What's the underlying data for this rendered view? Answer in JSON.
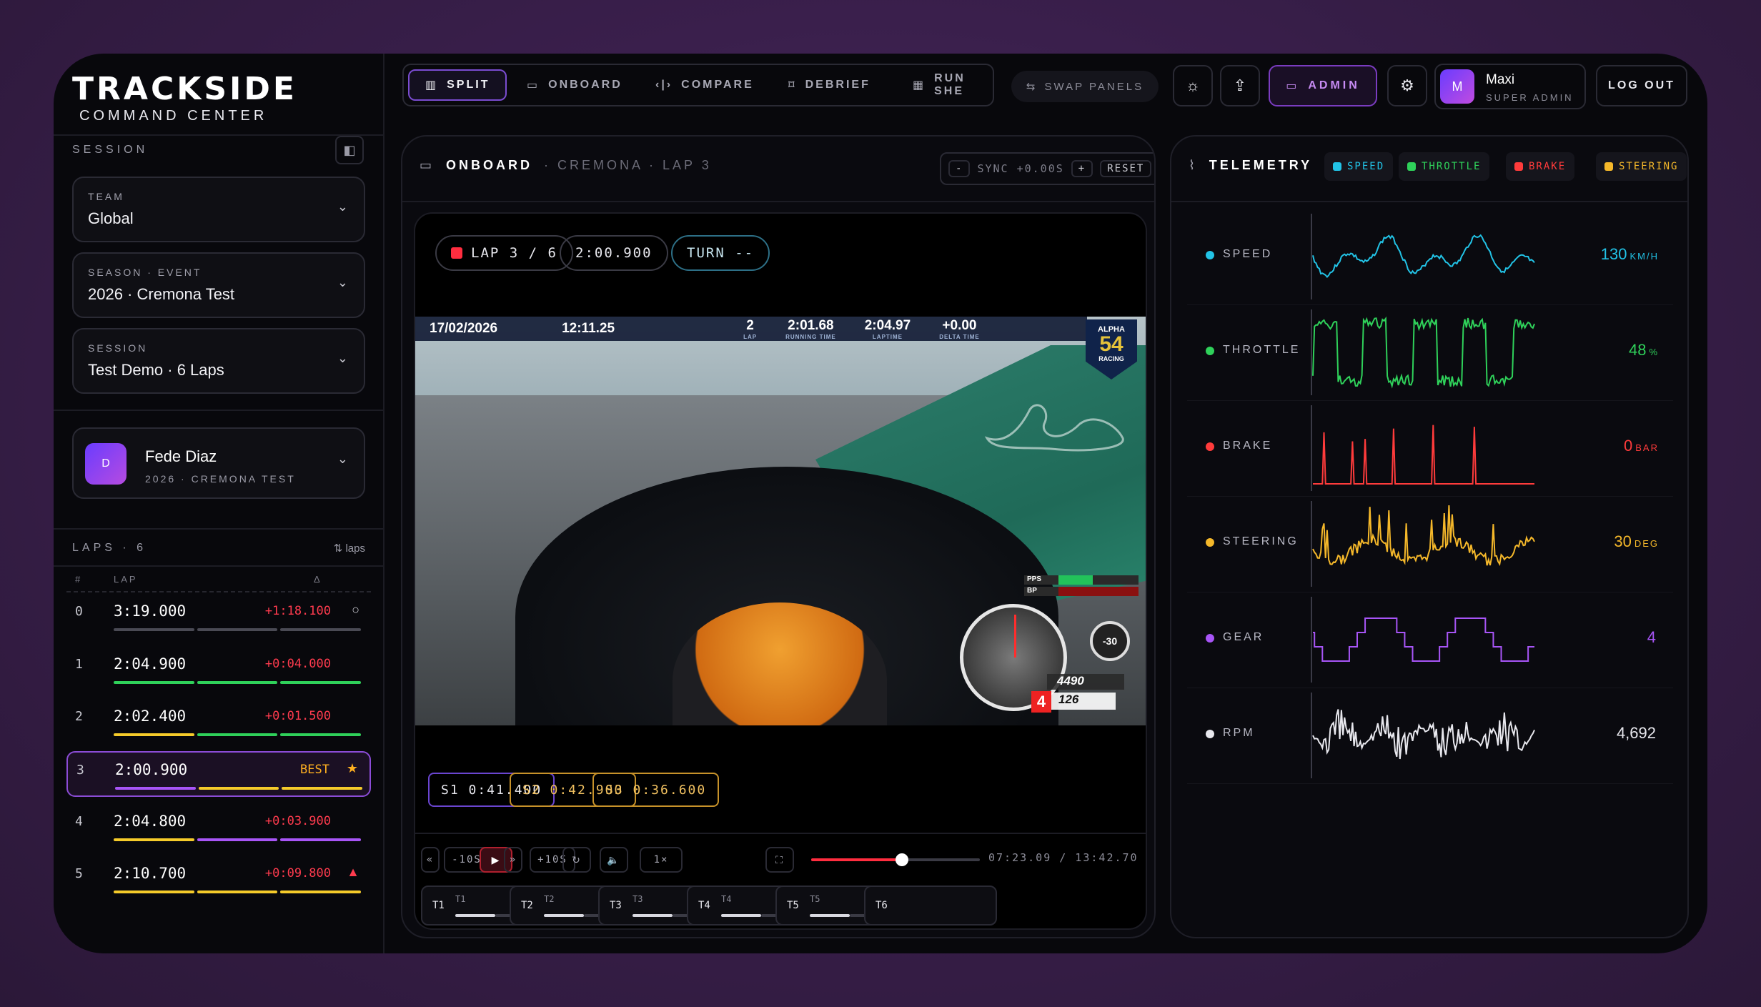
{
  "brand": {
    "title": "TRACKSIDE",
    "subtitle": "COMMAND CENTER"
  },
  "sidebar": {
    "session_title": "SESSION",
    "selects": [
      {
        "label": "TEAM",
        "value": "Global"
      },
      {
        "label": "SEASON · EVENT",
        "value": "2026 · Cremona Test"
      },
      {
        "label": "SESSION",
        "value": "Test Demo · 6 Laps"
      }
    ],
    "driver": {
      "initial": "D",
      "name": "Fede Diaz",
      "sub": "2026 · CREMONA TEST"
    },
    "laps_title": "LAPS · 6",
    "laps_sort": "laps",
    "columns": {
      "num": "#",
      "lap": "LAP",
      "delta": "Δ"
    },
    "laps": [
      {
        "num": "0",
        "time": "3:19.000",
        "delta": "+1:18.100",
        "mark": "○",
        "bars": [
          "#4a4a54",
          "#4a4a54",
          "#4a4a54"
        ]
      },
      {
        "num": "1",
        "time": "2:04.900",
        "delta": "+0:04.000",
        "mark": "",
        "bars": [
          "#2fd15a",
          "#2fd15a",
          "#2fd15a"
        ]
      },
      {
        "num": "2",
        "time": "2:02.400",
        "delta": "+0:01.500",
        "mark": "",
        "bars": [
          "#f5cb2a",
          "#2fd15a",
          "#2fd15a"
        ]
      },
      {
        "num": "3",
        "time": "2:00.900",
        "delta": "BEST",
        "mark": "★",
        "bars": [
          "#a855f7",
          "#f5cb2a",
          "#f5cb2a"
        ]
      },
      {
        "num": "4",
        "time": "2:04.800",
        "delta": "+0:03.900",
        "mark": "",
        "bars": [
          "#f5cb2a",
          "#a855f7",
          "#a855f7"
        ]
      },
      {
        "num": "5",
        "time": "2:10.700",
        "delta": "+0:09.800",
        "mark": "▲",
        "bars": [
          "#f5cb2a",
          "#f5cb2a",
          "#f5cb2a"
        ]
      }
    ]
  },
  "nav": {
    "tabs": [
      {
        "label": "SPLIT",
        "icon": "columns-icon"
      },
      {
        "label": "ONBOARD",
        "icon": "camera-icon"
      },
      {
        "label": "COMPARE",
        "icon": "compare-icon"
      },
      {
        "label": "DEBRIEF",
        "icon": "bookmark-icon"
      },
      {
        "label": "RUN SHE",
        "icon": "grid-icon"
      }
    ],
    "swap": "SWAP PANELS",
    "admin": "ADMIN",
    "user": {
      "initial": "M",
      "name": "Maxi",
      "role": "SUPER ADMIN"
    },
    "logout": "LOG OUT"
  },
  "onboard": {
    "title": "ONBOARD",
    "context": "· CREMONA · LAP 3",
    "sync": {
      "minus": "-",
      "label": "SYNC +0.00S",
      "plus": "+",
      "reset": "RESET"
    },
    "chips": {
      "lap": "LAP 3 / 6",
      "time": "2:00.900",
      "turn": "TURN --"
    },
    "hud": {
      "date": "17/02/2026",
      "clock": "12:11.25",
      "lap": "2",
      "lap_sub": "LAP",
      "running": "2:01.68",
      "running_sub": "RUNNING TIME",
      "laptime": "2:04.97",
      "laptime_sub": "LAPTIME",
      "delta": "+0.00",
      "delta_sub": "DELTA TIME",
      "badge": [
        "ALPHA",
        "54",
        "RACING"
      ],
      "pps": "PPS",
      "bp": "BP",
      "rpm": "4490",
      "gear": "4",
      "speed": "126",
      "round": "-30"
    },
    "sectors": [
      {
        "label": "S1 0:41.400",
        "color": "#7a55e0"
      },
      {
        "label": "S2 0:42.900",
        "color": "#d9a52a"
      },
      {
        "label": "S3 0:36.600",
        "color": "#d9a52a"
      }
    ],
    "controls": {
      "rew": "«",
      "back10": "-10S",
      "fwd": "»",
      "fwd10": "+10S",
      "speed": "1×"
    },
    "playback": {
      "current": "07:23.09",
      "total": "13:42.70",
      "progress": 0.54
    },
    "time_readout": "07:23.09  /  13:42.70",
    "turns": [
      {
        "label": "T1",
        "sub": "T1",
        "value": "--"
      },
      {
        "label": "T2",
        "sub": "T2",
        "value": "--"
      },
      {
        "label": "T3",
        "sub": "T3",
        "value": "--"
      },
      {
        "label": "T4",
        "sub": "T4",
        "value": "--"
      },
      {
        "label": "T5",
        "sub": "T5",
        "value": "--"
      },
      {
        "label": "T6",
        "sub": "",
        "value": ""
      }
    ]
  },
  "telemetry": {
    "title": "TELEMETRY",
    "legend": [
      {
        "label": "SPEED",
        "color": "#22c3e6"
      },
      {
        "label": "THROTTLE",
        "color": "#2fd15a"
      },
      {
        "label": "BRAKE",
        "color": "#ff3b3b"
      },
      {
        "label": "STEERING",
        "color": "#f5b82a"
      }
    ],
    "channels": [
      {
        "name": "SPEED",
        "value": "130",
        "unit": "KM/H",
        "color": "#22c3e6"
      },
      {
        "name": "THROTTLE",
        "value": "48",
        "unit": "%",
        "color": "#2fd15a"
      },
      {
        "name": "BRAKE",
        "value": "0",
        "unit": "BAR",
        "color": "#ff3b3b"
      },
      {
        "name": "STEERING",
        "value": "30",
        "unit": "DEG",
        "color": "#f5b82a"
      },
      {
        "name": "GEAR",
        "value": "4",
        "unit": "",
        "color": "#a855f7"
      },
      {
        "name": "RPM",
        "value": "4,692",
        "unit": "",
        "color": "#e8e8ee"
      }
    ]
  }
}
